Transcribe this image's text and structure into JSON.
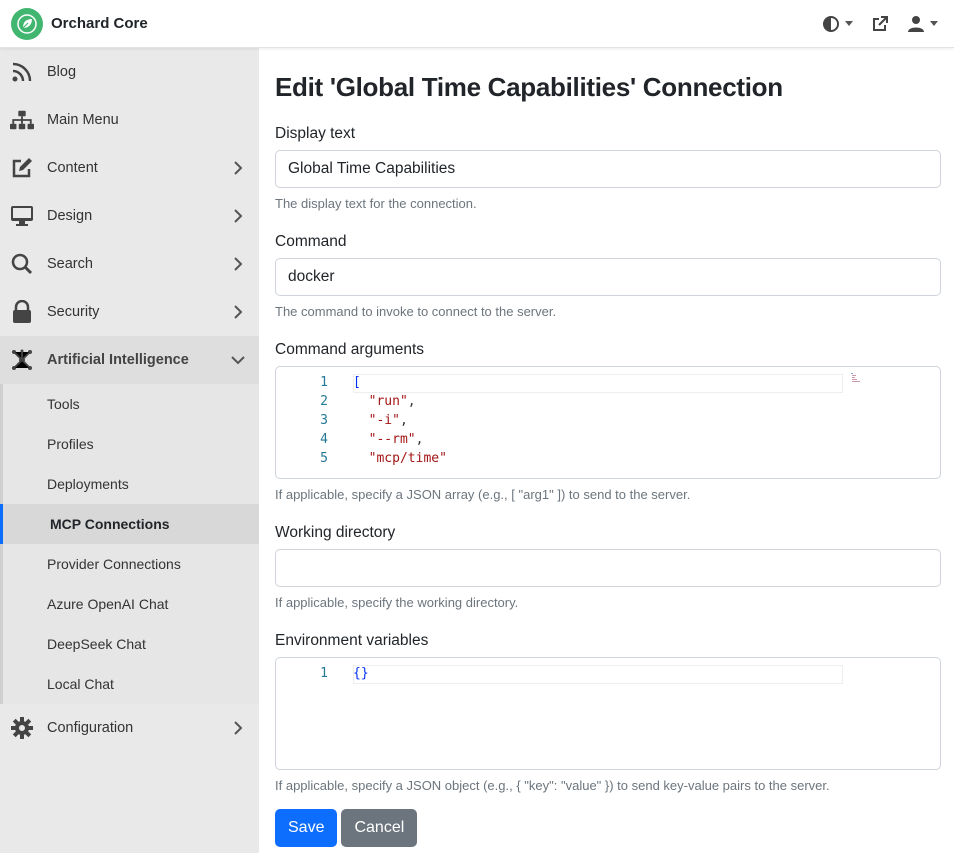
{
  "app": {
    "brand": "Orchard Core"
  },
  "topbar": {
    "theme_icon": "contrast-icon",
    "external_icon": "external-link-icon",
    "user_icon": "user-icon"
  },
  "sidebar": {
    "items": [
      {
        "label": "Blog",
        "icon": "rss-icon"
      },
      {
        "label": "Main Menu",
        "icon": "sitemap-icon"
      },
      {
        "label": "Content",
        "icon": "edit-icon"
      },
      {
        "label": "Design",
        "icon": "monitor-icon"
      },
      {
        "label": "Search",
        "icon": "search-icon"
      },
      {
        "label": "Security",
        "icon": "lock-icon"
      },
      {
        "label": "Artificial Intelligence",
        "icon": "ai-network-icon"
      },
      {
        "label": "Configuration",
        "icon": "gear-icon"
      }
    ],
    "ai_sub": [
      {
        "label": "Tools"
      },
      {
        "label": "Profiles"
      },
      {
        "label": "Deployments"
      },
      {
        "label": "MCP Connections"
      },
      {
        "label": "Provider Connections"
      },
      {
        "label": "Azure OpenAI Chat"
      },
      {
        "label": "DeepSeek Chat"
      },
      {
        "label": "Local Chat"
      }
    ]
  },
  "main": {
    "title": "Edit 'Global Time Capabilities' Connection",
    "display_text": {
      "label": "Display text",
      "value": "Global Time Capabilities",
      "hint": "The display text for the connection."
    },
    "command": {
      "label": "Command",
      "value": "docker",
      "hint": "The command to invoke to connect to the server."
    },
    "command_args": {
      "label": "Command arguments",
      "line_numbers": [
        "1",
        "2",
        "3",
        "4",
        "5"
      ],
      "lines": [
        "[",
        "\"run\"",
        "\"-i\"",
        "\"--rm\"",
        "\"mcp/time\""
      ],
      "hint": "If applicable, specify a JSON array (e.g., [ \"arg1\" ]) to send to the server."
    },
    "working_dir": {
      "label": "Working directory",
      "value": "",
      "hint": "If applicable, specify the working directory."
    },
    "env_vars": {
      "label": "Environment variables",
      "line_numbers": [
        "1"
      ],
      "lines": [
        "{}"
      ],
      "hint": "If applicable, specify a JSON object (e.g., { \"key\": \"value\" }) to send key-value pairs to the server."
    },
    "save_label": "Save",
    "cancel_label": "Cancel"
  },
  "colors": {
    "primary": "#0d6efd",
    "secondary": "#6c757d",
    "sidebar_bg": "#e9e9e9",
    "brand_green": "#41b670"
  }
}
